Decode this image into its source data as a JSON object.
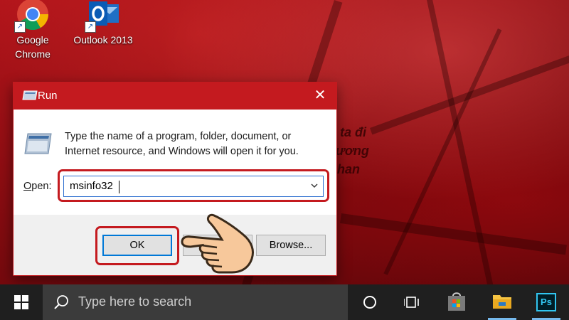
{
  "desktop": {
    "icons": [
      {
        "label_line1": "Google",
        "label_line2": "Chrome",
        "icon": "chrome-icon"
      },
      {
        "label_line1": "Outlook 2013",
        "label_line2": "",
        "icon": "outlook-icon"
      }
    ],
    "bg_text": [
      "ta đi",
      "ương",
      "han"
    ]
  },
  "run_dialog": {
    "title": "Run",
    "close_glyph": "✕",
    "description": "Type the name of a program, folder, document, or Internet resource, and Windows will open it for you.",
    "open_label_prefix": "",
    "open_label_underlined": "O",
    "open_label_rest": "pen:",
    "open_value": "msinfo32",
    "ok_label": "OK",
    "browse_label": "Browse...",
    "accent": "#c41a1f"
  },
  "taskbar": {
    "search_placeholder": "Type here to search",
    "icons": [
      "windows-start-icon",
      "cortana-icon",
      "task-view-icon",
      "store-icon",
      "file-explorer-icon",
      "photoshop-icon"
    ],
    "photoshop_label": "Ps"
  }
}
